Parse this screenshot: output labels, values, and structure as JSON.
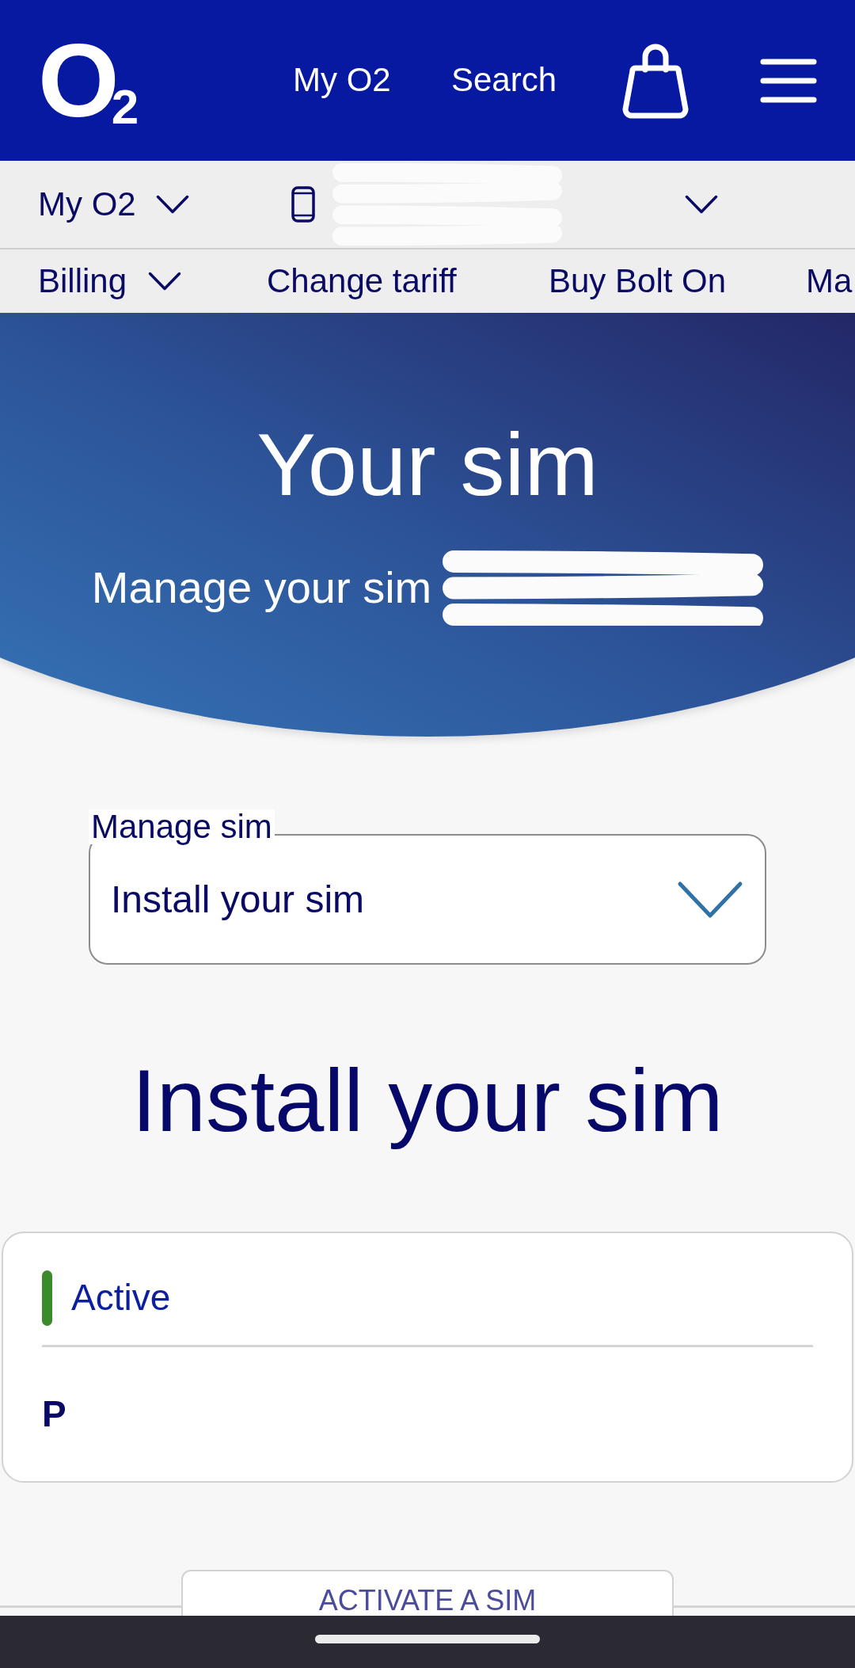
{
  "header": {
    "logo": {
      "letter": "O",
      "subscript": "2"
    },
    "links": [
      "My O2",
      "Search"
    ]
  },
  "account_bar": {
    "menu": "My O2"
  },
  "nav_tabs": [
    {
      "label": "Billing",
      "kind": "dropdown"
    },
    {
      "label": "Change tariff",
      "kind": "link"
    },
    {
      "label": "Buy Bolt On",
      "kind": "link"
    },
    {
      "label": "Ma",
      "kind": "link"
    }
  ],
  "hero": {
    "title": "Your sim",
    "subtitle": "Manage your sim"
  },
  "manage_sim_select": {
    "label": "Manage sim",
    "value": "Install your sim"
  },
  "section_title": "Install your sim",
  "sim_card": {
    "status": {
      "label": "Active",
      "color": "#3b8a2c"
    },
    "name": "P"
  },
  "primary_button": "ACTIVATE A SIM"
}
